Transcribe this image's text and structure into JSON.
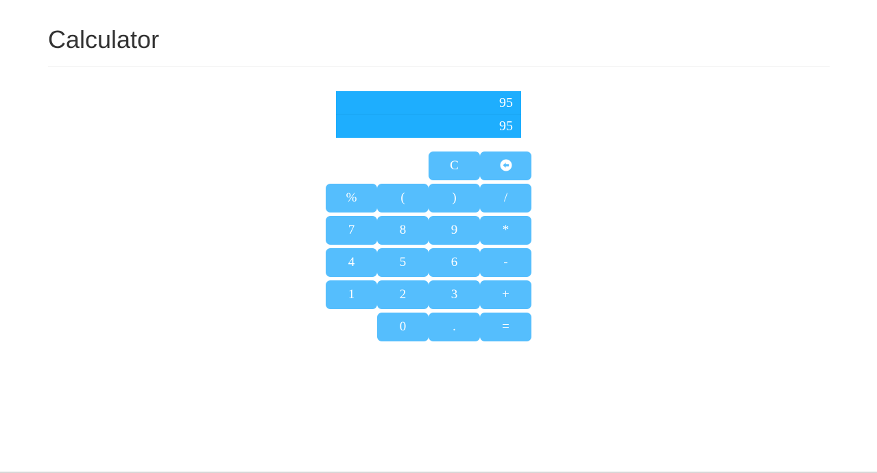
{
  "header": {
    "title": "Calculator"
  },
  "display": {
    "expression": "95",
    "result": "95"
  },
  "keys": {
    "clear": "C",
    "backspace_icon": "backspace-circle-arrow-left-icon",
    "percent": "%",
    "open_paren": "(",
    "close_paren": ")",
    "divide": "/",
    "seven": "7",
    "eight": "8",
    "nine": "9",
    "multiply": "*",
    "four": "4",
    "five": "5",
    "six": "6",
    "subtract": "-",
    "one": "1",
    "two": "2",
    "three": "3",
    "add": "+",
    "zero": "0",
    "decimal": ".",
    "equals": "="
  },
  "colors": {
    "display_bg": "#1eaefe",
    "key_bg": "#55befd",
    "key_text": "#ffffff",
    "title_text": "#333333"
  }
}
